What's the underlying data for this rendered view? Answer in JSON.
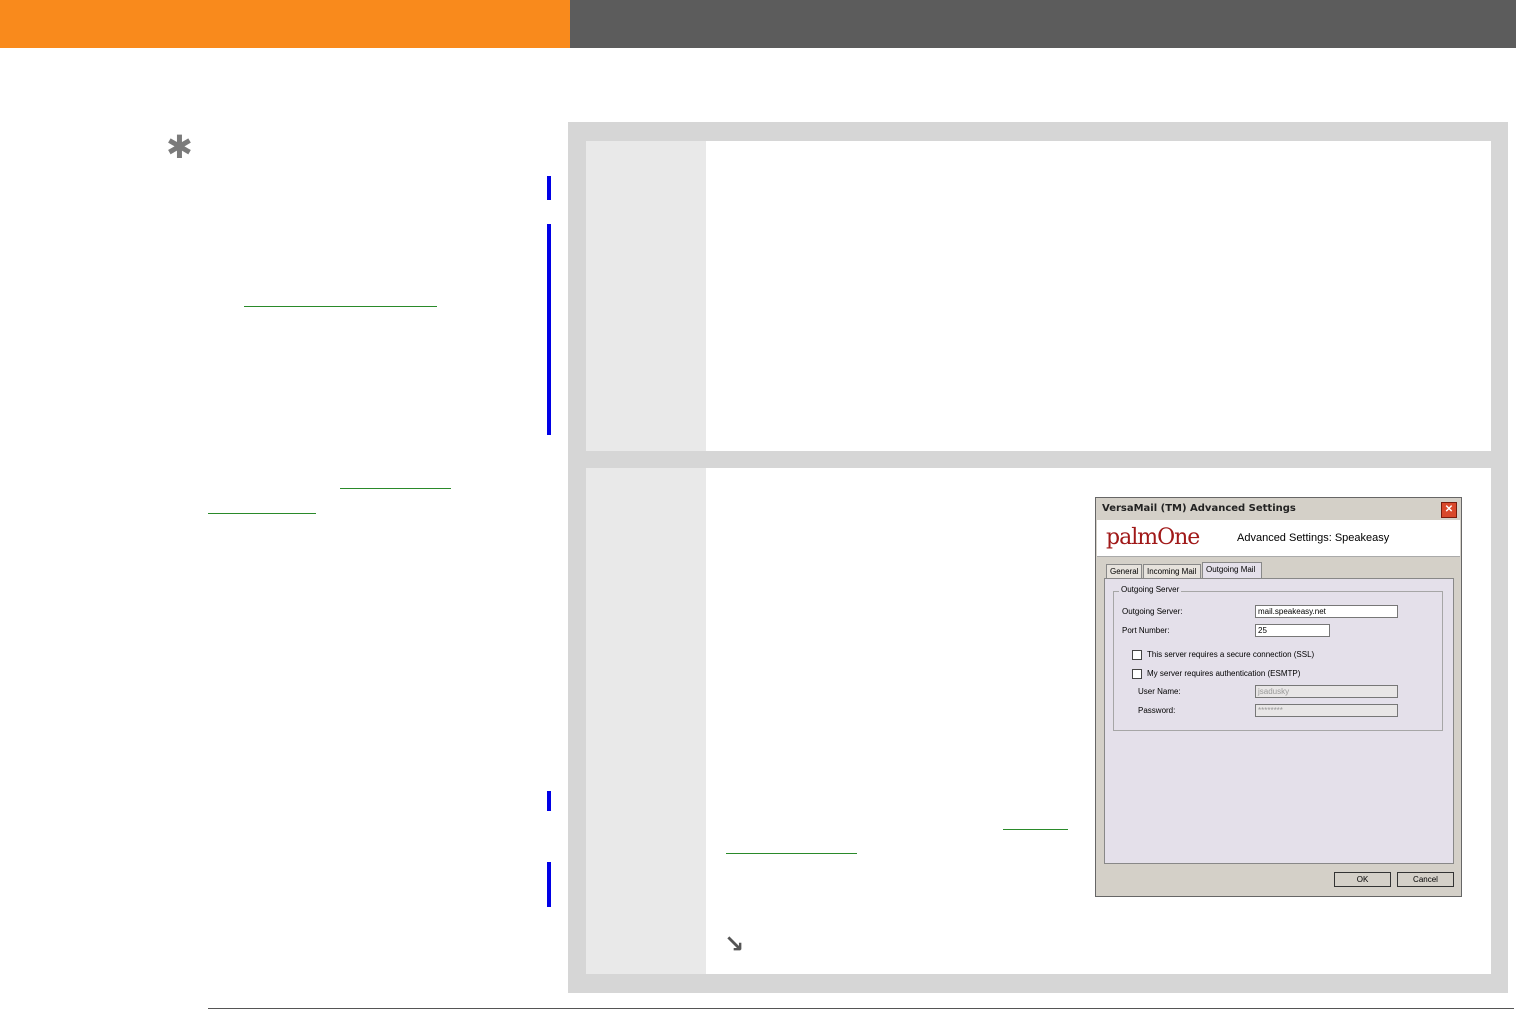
{
  "tip": {
    "icon": "asterisk-icon"
  },
  "dialog": {
    "title": "VersaMail (TM) Advanced Settings",
    "logo": "palmOne",
    "heading": "Advanced Settings: Speakeasy",
    "tabs": [
      "General",
      "Incoming Mail",
      "Outgoing Mail"
    ],
    "group_label": "Outgoing Server",
    "fields": {
      "outgoing_server_label": "Outgoing Server:",
      "outgoing_server_value": "mail.speakeasy.net",
      "port_label": "Port Number:",
      "port_value": "25",
      "ssl_label": "This server requires a secure connection (SSL)",
      "auth_label": "My server requires authentication (ESMTP)",
      "user_label": "User Name:",
      "user_value": "jsadusky",
      "password_label": "Password:",
      "password_value": "********"
    },
    "ok_label": "OK",
    "cancel_label": "Cancel",
    "close_glyph": "✕"
  },
  "continue_icon": "continue-arrow-icon",
  "colors": {
    "orange": "#f98a1c",
    "header_grey": "#5c5c5c",
    "link_green": "#2a8a2a",
    "blue_mark": "#0000e6"
  }
}
